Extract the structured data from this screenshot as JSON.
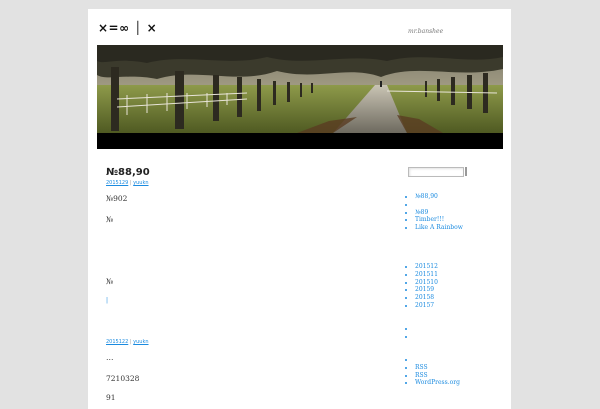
{
  "site": {
    "title": "×=∞ │ ×",
    "description": "mr.banshee"
  },
  "posts": [
    {
      "title": "№88,90",
      "meta": {
        "date": "2015129",
        "author": "yuukn"
      },
      "paragraphs": [
        "№902",
        "№",
        "№"
      ],
      "more": "  |  "
    },
    {
      "meta": {
        "date": "2015122",
        "author": "yuukn"
      },
      "paragraphs": [
        "…",
        "7210328",
        "91"
      ]
    }
  ],
  "sidebar": {
    "search": {
      "value": "",
      "placeholder": ""
    },
    "recent_posts": [
      "№88,90",
      "",
      "№89",
      "Timber!!!",
      "Like A Rainbow"
    ],
    "archives": [
      "201512",
      "201511",
      "201510",
      "20159",
      "20158",
      "20157"
    ],
    "categories": [
      "",
      ""
    ],
    "meta": [
      "",
      "RSS",
      "RSS",
      "WordPress.org"
    ]
  },
  "colors": {
    "background": "#e2e2e2",
    "page": "#ffffff",
    "link": "#1b8be0",
    "header_bar": "#000000"
  }
}
